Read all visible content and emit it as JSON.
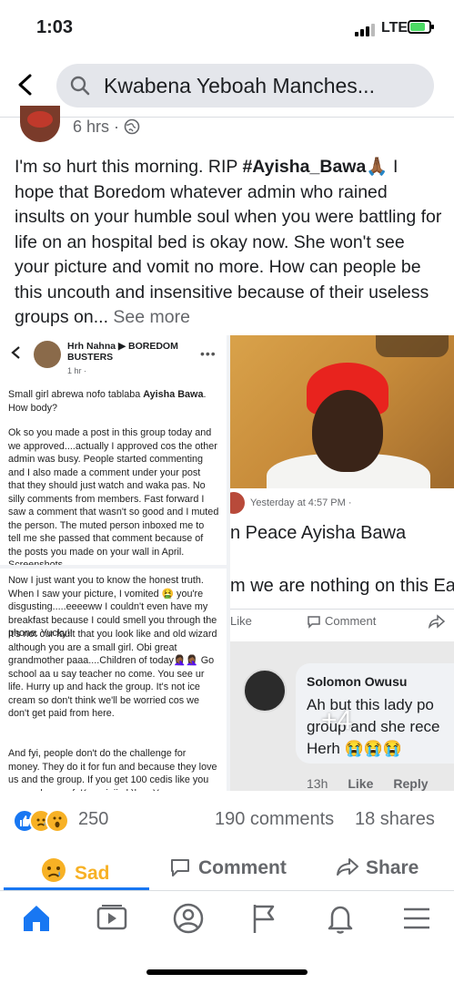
{
  "status": {
    "time": "1:03",
    "network": "LTE"
  },
  "search": {
    "query": "Kwabena Yeboah Manches..."
  },
  "post": {
    "meta": "6 hrs ·",
    "text_before": "I'm so hurt this morning. RIP ",
    "hashtag": "#Ayisha_Bawa",
    "emoji": "🙏🏾",
    "text_after": " I hope that Boredom whatever admin who rained insults on your humble soul when you were battling for life on an hospital bed is okay now. She won't see your picture and vomit no more. How can people be this uncouth and insensitive because of their useless groups on...",
    "see_more": "See more"
  },
  "screenshot1": {
    "author": "Hrh Nahna ▶ BOREDOM BUSTERS",
    "time": "1 hr ·",
    "dots": "•••",
    "p1a": "Small girl abrewa nofo tablaba ",
    "p1b": "Ayisha Bawa",
    "p1c": ". How body?",
    "p2": "Ok so you made a post in this group today and we approved....actually I approved cos the other admin was busy. People started commenting and I also made a comment under your post that they should just watch and waka pas. No silly comments from members. Fast forward I saw a comment that wasn't so good and I muted the person. The muted person inboxed me to tell me she passed that comment because of the posts you made on your wall in April. Screenshots"
  },
  "screenshot2": {
    "p1": "Now I just want you to know the honest truth. When I saw your picture, I vomited 🤮 you're disgusting.....eeeeww I couldn't even have my breakfast because I could smell you through the phone. Yucky!!",
    "p2": "It's not our fault that you look like and old wizard although you are a small girl. Obi great grandmother paaa....Children of today🤦🏾‍♀️🤦🏾‍♀️ Go school aa u say teacher no come. You see ur life. Hurry up and hack the group. It's not ice cream so don't think we'll be worried cos we don't get paid from here.",
    "p3": "And fyi, people don't do the challenge for money. They do it for fun and because they love us and the group. If you get 100 cedis like you no go sleep sef. Kurasinii ak)laa. You"
  },
  "photo4": {
    "time": "Yesterday at 4:57 PM ·",
    "line1": "n Peace Ayisha Bawa",
    "line2": "m we are nothing on this Ea",
    "like": "Like",
    "comment": "Comment"
  },
  "photo5": {
    "name": "Solomon Owusu",
    "text": "Ah but this lady po\ngroup and she rece\nHerh 😭😭😭",
    "time": "13h",
    "like": "Like",
    "reply": "Reply",
    "more": "+4"
  },
  "stats": {
    "reactions": "250",
    "comments": "190 comments",
    "shares": "18 shares"
  },
  "actions": {
    "sad": "Sad",
    "comment": "Comment",
    "share": "Share"
  },
  "colors": {
    "accent": "#1877f2",
    "sad": "#f7b125",
    "muted": "#65676b"
  }
}
